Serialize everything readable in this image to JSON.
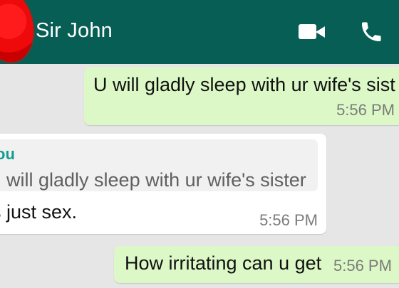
{
  "header": {
    "contact_name": "Sir John",
    "background": "#075e54",
    "icons": {
      "avatar": "avatar",
      "video_call": "video-camera-icon",
      "voice_call": "phone-icon"
    }
  },
  "messages": [
    {
      "direction": "outgoing",
      "text": "U will gladly sleep with ur wife's sist",
      "time": "5:56 PM"
    },
    {
      "direction": "incoming",
      "quoted_author": "ou",
      "quoted_text": "J will gladly sleep with ur wife's sister",
      "text": "s just sex.",
      "time": "5:56 PM"
    },
    {
      "direction": "outgoing",
      "text": "How irritating can u get",
      "time": "5:56 PM"
    }
  ],
  "colors": {
    "chat_background": "#e6e6e6",
    "outgoing_bubble": "#dcf8c6",
    "incoming_bubble": "#ffffff",
    "quote_author": "#149d8f"
  }
}
